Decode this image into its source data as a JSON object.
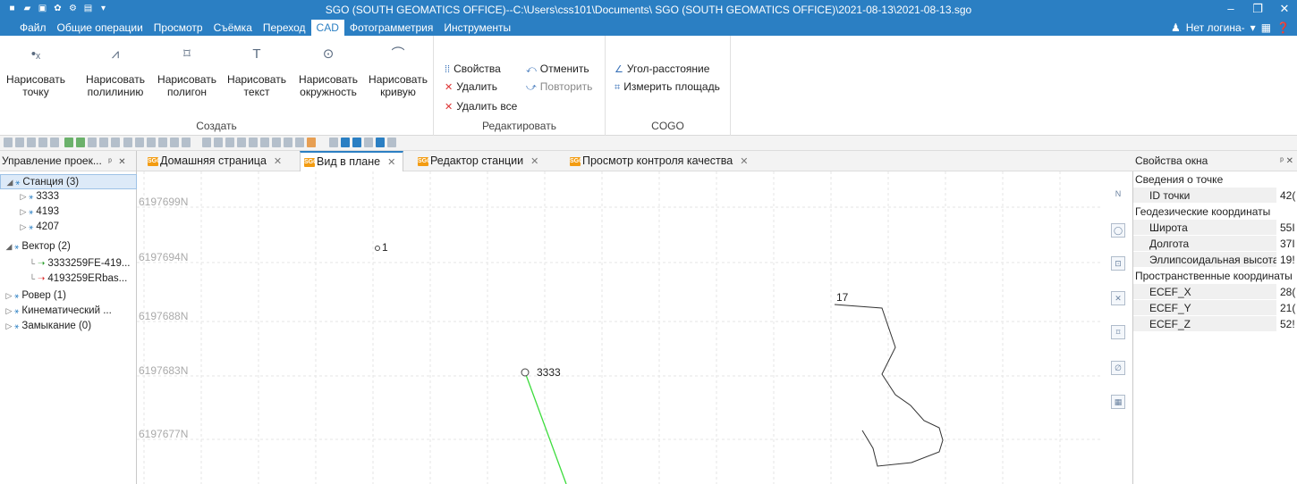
{
  "window": {
    "title": "SGO (SOUTH GEOMATICS OFFICE)--C:\\Users\\css101\\Documents\\ SGO (SOUTH GEOMATICS OFFICE)\\2021-08-13\\2021-08-13.sgo"
  },
  "menu": {
    "items": [
      "Файл",
      "Общие операции",
      "Просмотр",
      "Съёмка",
      "Переход",
      "CAD",
      "Фотограмметрия",
      "Инструменты"
    ],
    "active": "CAD",
    "user": "Нет логина-"
  },
  "ribbon": {
    "create": {
      "label": "Создать",
      "buttons": [
        {
          "l1": "Нарисовать",
          "l2": "точку"
        },
        {
          "l1": "Нарисовать",
          "l2": "полилинию"
        },
        {
          "l1": "Нарисовать",
          "l2": "полигон"
        },
        {
          "l1": "Нарисовать",
          "l2": "текст"
        },
        {
          "l1": "Нарисовать",
          "l2": "окружность"
        },
        {
          "l1": "Нарисовать",
          "l2": "кривую"
        }
      ]
    },
    "edit": {
      "label": "Редактировать",
      "properties": "Свойства",
      "delete": "Удалить",
      "delete_all": "Удалить все",
      "undo": "Отменить",
      "redo": "Повторить"
    },
    "cogo": {
      "label": "COGO",
      "angle_distance": "Угол-расстояние",
      "measure_area": "Измерить площадь"
    }
  },
  "left_panel": {
    "title": "Управление проек...",
    "tree": [
      {
        "label": "Станция (3)",
        "level": 0,
        "expanded": true,
        "selected": true
      },
      {
        "label": "3333",
        "level": 1
      },
      {
        "label": "4193",
        "level": 1
      },
      {
        "label": "4207",
        "level": 1
      },
      {
        "label": "Вектор (2)",
        "level": 0,
        "expanded": true
      },
      {
        "label": "3333259FE-419...",
        "level": 2,
        "status": "ok"
      },
      {
        "label": "4193259ERbas...",
        "level": 2,
        "status": "error"
      },
      {
        "label": "Ровер (1)",
        "level": 0
      },
      {
        "label": "Кинематический ...",
        "level": 0
      },
      {
        "label": "Замыкание (0)",
        "level": 0
      }
    ]
  },
  "tabs": [
    {
      "label": "Домашняя страница"
    },
    {
      "label": "Вид в плане",
      "active": true
    },
    {
      "label": "Редактор станции"
    },
    {
      "label": "Просмотр контроля качества"
    }
  ],
  "tab_icon_text": "SGO",
  "plan_view": {
    "northing_labels": [
      "6197699N",
      "6197694N",
      "6197688N",
      "6197683N",
      "6197677N"
    ],
    "points": [
      {
        "label": "1"
      },
      {
        "label": "3333"
      },
      {
        "label": "17"
      }
    ],
    "vector_color": "#3ddc3d",
    "track_color": "#333333"
  },
  "right_panel": {
    "title": "Свойства окна",
    "sections": [
      {
        "title": "Сведения о точке",
        "rows": [
          {
            "key": "ID точки",
            "value": "42("
          }
        ]
      },
      {
        "title": "Геодезические координаты",
        "rows": [
          {
            "key": "Широта",
            "value": "55I"
          },
          {
            "key": "Долгота",
            "value": "37I"
          },
          {
            "key": "Эллипсоидальная высота",
            "value": "19!"
          }
        ]
      },
      {
        "title": "Пространственные координаты",
        "rows": [
          {
            "key": "ECEF_X",
            "value": "28("
          },
          {
            "key": "ECEF_Y",
            "value": "21("
          },
          {
            "key": "ECEF_Z",
            "value": "52!"
          }
        ]
      }
    ]
  },
  "colors": {
    "accent": "#2b7fc3",
    "tab_icon": "#f39c12"
  }
}
